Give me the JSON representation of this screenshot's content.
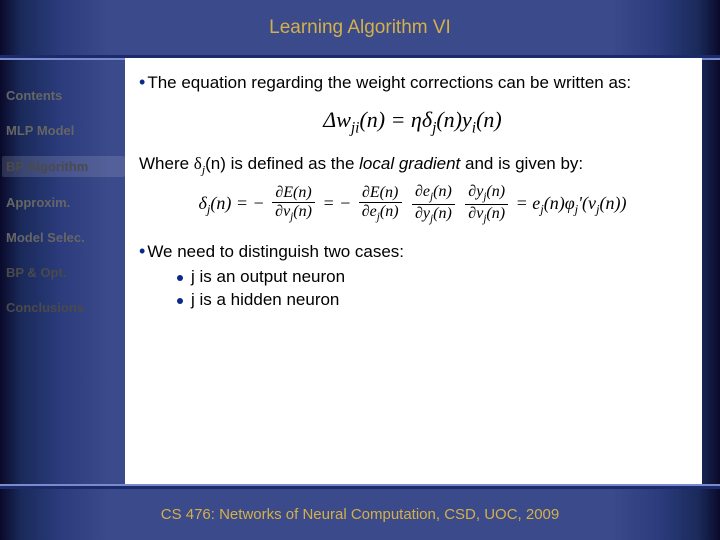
{
  "title": "Learning Algorithm VI",
  "sidebar": {
    "items": [
      {
        "label": "Contents",
        "active": false
      },
      {
        "label": "MLP Model",
        "active": false
      },
      {
        "label": "BP Algorithm",
        "active": true
      },
      {
        "label": "Approxim.",
        "active": false
      },
      {
        "label": "Model Selec.",
        "active": false
      },
      {
        "label": "BP & Opt.",
        "active": false
      },
      {
        "label": "Conclusions",
        "active": false
      }
    ]
  },
  "content": {
    "bullet1": "The equation regarding the weight corrections can be written as:",
    "eq1_text": "Δwji(n) = η δj(n) yi(n)",
    "para2_pre": "Where ",
    "para2_delta": "δ",
    "para2_sub": "j",
    "para2_mid": "(n) is defined as the ",
    "para2_italic": "local gradient",
    "para2_post": " and is given by:",
    "eq2_text": "δj(n) = −∂E(n)/∂vj(n) = −(∂E(n)/∂ej(n))(∂ej(n)/∂yj(n))(∂yj(n)/∂vj(n)) = ej(n)φ'j(vj(n))",
    "bullet2": "We need to distinguish two cases:",
    "sub_bullets": [
      "j is an output neuron",
      "j is a hidden neuron"
    ]
  },
  "footer": "CS 476: Networks of Neural Computation, CSD, UOC, 2009"
}
